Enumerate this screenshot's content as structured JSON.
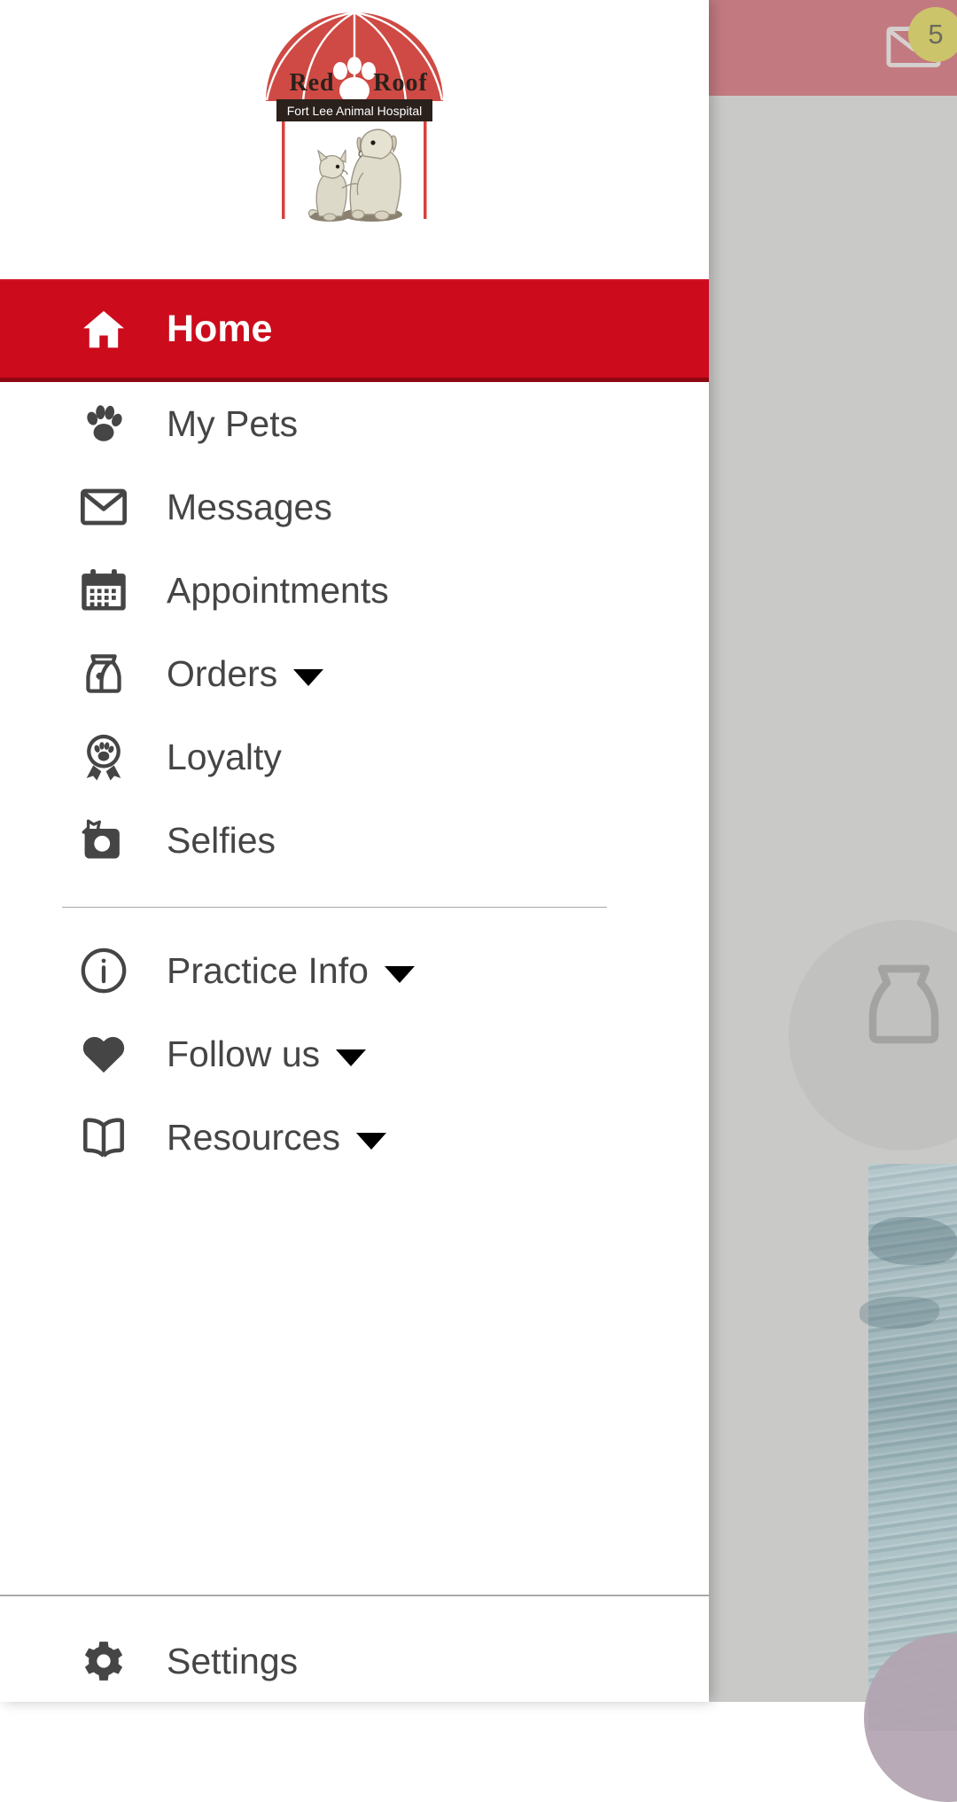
{
  "background": {
    "header_color": "#c27a80",
    "mail_icon": "mail-icon",
    "badge_count": "5",
    "badge_color": "#ccc46a",
    "food_bag_icon": "pet-food-bag-icon",
    "body_color": "#c9c9c7"
  },
  "drawer": {
    "close_icon": "close-icon",
    "logo": {
      "name": "red-roof-animal-hospital-logo",
      "title_left": "Red",
      "title_right": "Roof",
      "paw_icon": "paw-icon",
      "subtitle": "Fort Lee Animal Hospital",
      "dome_color": "#cf4a44",
      "banner_color": "#2b211c",
      "post_color": "#d8413c",
      "pets_illustration": "cat-and-dog-illustration"
    },
    "accent_color": "#cc0b1c",
    "text_color": "#454545",
    "primary_items": [
      {
        "label": "Home",
        "icon": "home-icon",
        "active": true,
        "caret": false
      },
      {
        "label": "My Pets",
        "icon": "paw-print-icon",
        "active": false,
        "caret": false
      },
      {
        "label": "Messages",
        "icon": "envelope-icon",
        "active": false,
        "caret": false
      },
      {
        "label": "Appointments",
        "icon": "calendar-icon",
        "active": false,
        "caret": false
      },
      {
        "label": "Orders",
        "icon": "pet-food-bag-icon",
        "active": false,
        "caret": true
      },
      {
        "label": "Loyalty",
        "icon": "award-paw-icon",
        "active": false,
        "caret": false
      },
      {
        "label": "Selfies",
        "icon": "camera-star-icon",
        "active": false,
        "caret": false
      }
    ],
    "secondary_items": [
      {
        "label": "Practice Info",
        "icon": "info-circle-icon",
        "caret": true
      },
      {
        "label": "Follow us",
        "icon": "heart-icon",
        "caret": true
      },
      {
        "label": "Resources",
        "icon": "open-book-icon",
        "caret": true
      }
    ],
    "footer": {
      "settings_label": "Settings",
      "settings_icon": "gear-icon"
    }
  }
}
